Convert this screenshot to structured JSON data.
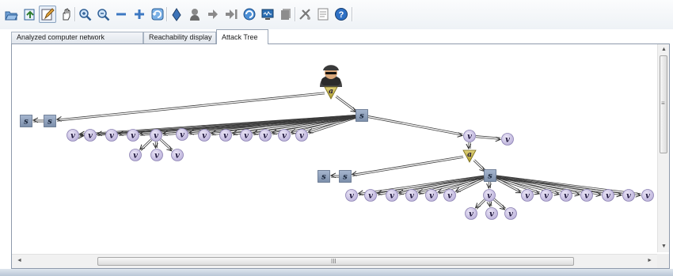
{
  "toolbar": {
    "icons": [
      "open-folder-icon",
      "export-icon",
      "edit-mode-icon",
      "hand-pan-icon",
      "zoom-in-icon",
      "zoom-out-icon",
      "collapse-minus-icon",
      "expand-plus-icon",
      "refresh-icon",
      "marker-icon",
      "attacker-icon",
      "step-forward-icon",
      "step-end-icon",
      "network-icon",
      "monitor-icon",
      "document-stack-icon",
      "tools-icon",
      "notes-icon",
      "help-icon"
    ]
  },
  "tabs": [
    {
      "label": "Analyzed computer network",
      "selected": false
    },
    {
      "label": "Reachability display",
      "selected": false
    },
    {
      "label": "Attack Tree",
      "selected": true
    }
  ],
  "graph": {
    "node_labels": {
      "state": "s",
      "vulnerability": "v",
      "attack": "a"
    },
    "colors": {
      "state_fill": "#8c9fbb",
      "vuln_fill": "#cfc6e6",
      "attack_fill": "#c9b84a",
      "edge": "#3a3a3a"
    }
  },
  "scrollbars": {
    "horizontal_grip": "III",
    "vertical_grip": "≡"
  }
}
